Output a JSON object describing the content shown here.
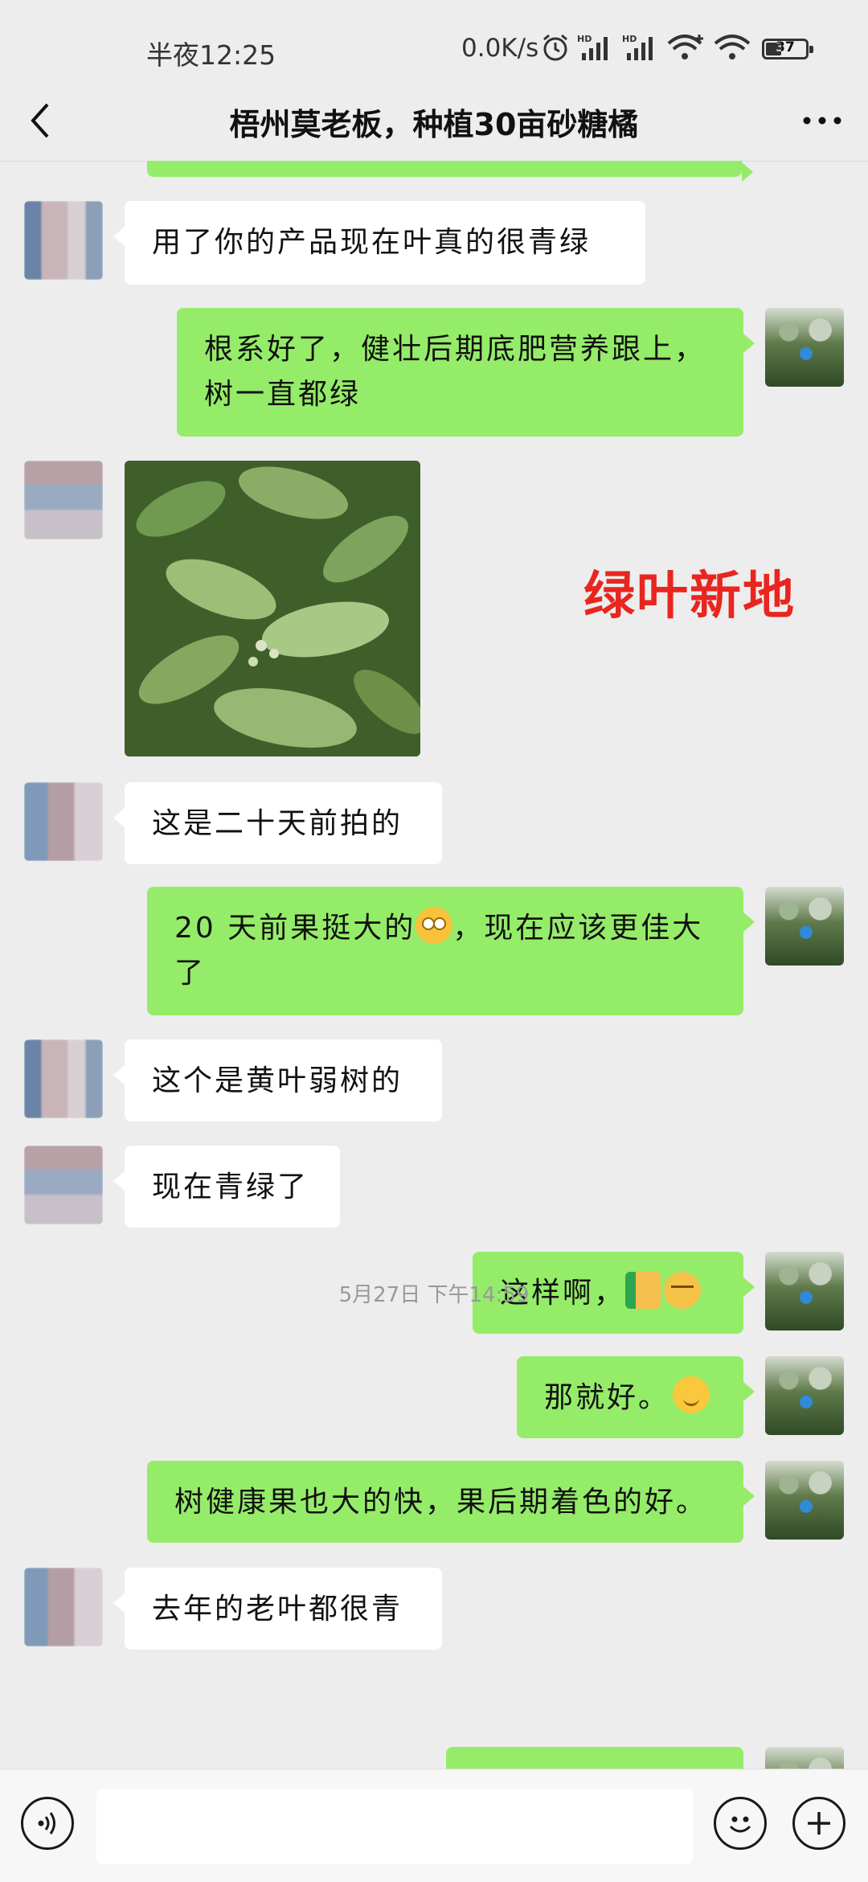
{
  "status_bar": {
    "time": "半夜12:25",
    "net_speed": "0.0K/s",
    "battery_level": "37",
    "icons": [
      "alarm-icon",
      "hd-signal-icon",
      "hd-signal-icon",
      "wifi-plus-icon",
      "wifi-icon",
      "battery-icon"
    ]
  },
  "header": {
    "title": "梧州莫老板，种植30亩砂糖橘",
    "back_icon": "chevron-left-icon",
    "more_icon": "more-dots-icon"
  },
  "messages": [
    {
      "side": "left",
      "text": "用了你的产品现在叶真的很青绿"
    },
    {
      "side": "right",
      "text": "根系好了，健壮后期底肥营养跟上，\n树一直都绿"
    },
    {
      "side": "left",
      "type": "image"
    },
    {
      "side": "left",
      "text": "这是二十天前拍的"
    },
    {
      "side": "right",
      "text_a": "20 天前果挺大的",
      "text_b": "，现在应该更佳大\n了"
    },
    {
      "side": "left",
      "text": "这个是黄叶弱树的"
    },
    {
      "side": "left",
      "text": "现在青绿了"
    },
    {
      "side": "right",
      "text": "这样啊，"
    },
    {
      "side": "right",
      "text": "那就好。"
    },
    {
      "side": "right",
      "text": "树健康果也大的快，果后期着色的好。"
    },
    {
      "side": "left",
      "text": "去年的老叶都很青"
    }
  ],
  "watermark": "绿叶新地",
  "timestamp": "5月27日 下午14:59",
  "input_bar": {
    "voice_icon": "voice-icon",
    "emoji_icon": "smiley-icon",
    "plus_icon": "plus-icon",
    "placeholder": ""
  },
  "colors": {
    "background": "#ededed",
    "outgoing_bubble": "#95ec69",
    "incoming_bubble": "#ffffff",
    "watermark": "#e8261f"
  }
}
